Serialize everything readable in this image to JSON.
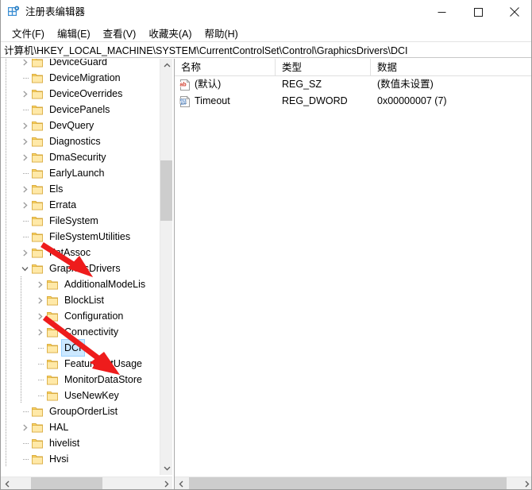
{
  "window": {
    "title": "注册表编辑器",
    "app_icon": "registry-editor-icon",
    "minimize_label": "最小化",
    "maximize_label": "最大化",
    "close_label": "关闭"
  },
  "menubar": {
    "items": [
      {
        "label": "文件(F)",
        "name": "menu-file"
      },
      {
        "label": "编辑(E)",
        "name": "menu-edit"
      },
      {
        "label": "查看(V)",
        "name": "menu-view"
      },
      {
        "label": "收藏夹(A)",
        "name": "menu-favorites"
      },
      {
        "label": "帮助(H)",
        "name": "menu-help"
      }
    ]
  },
  "address": {
    "path": "计算机\\HKEY_LOCAL_MACHINE\\SYSTEM\\CurrentControlSet\\Control\\GraphicsDrivers\\DCI"
  },
  "tree": {
    "items": [
      {
        "label": "DeviceGuard",
        "indent": 1,
        "expandable": true,
        "expanded": false,
        "selected": false
      },
      {
        "label": "DeviceMigration",
        "indent": 1,
        "expandable": false,
        "expanded": false,
        "selected": false
      },
      {
        "label": "DeviceOverrides",
        "indent": 1,
        "expandable": true,
        "expanded": false,
        "selected": false
      },
      {
        "label": "DevicePanels",
        "indent": 1,
        "expandable": false,
        "expanded": false,
        "selected": false
      },
      {
        "label": "DevQuery",
        "indent": 1,
        "expandable": true,
        "expanded": false,
        "selected": false
      },
      {
        "label": "Diagnostics",
        "indent": 1,
        "expandable": true,
        "expanded": false,
        "selected": false
      },
      {
        "label": "DmaSecurity",
        "indent": 1,
        "expandable": true,
        "expanded": false,
        "selected": false
      },
      {
        "label": "EarlyLaunch",
        "indent": 1,
        "expandable": false,
        "expanded": false,
        "selected": false
      },
      {
        "label": "Els",
        "indent": 1,
        "expandable": true,
        "expanded": false,
        "selected": false
      },
      {
        "label": "Errata",
        "indent": 1,
        "expandable": true,
        "expanded": false,
        "selected": false
      },
      {
        "label": "FileSystem",
        "indent": 1,
        "expandable": false,
        "expanded": false,
        "selected": false
      },
      {
        "label": "FileSystemUtilities",
        "indent": 1,
        "expandable": false,
        "expanded": false,
        "selected": false
      },
      {
        "label": "FntAssoc",
        "indent": 1,
        "expandable": true,
        "expanded": false,
        "selected": false
      },
      {
        "label": "GraphicsDrivers",
        "indent": 1,
        "expandable": true,
        "expanded": true,
        "selected": false
      },
      {
        "label": "AdditionalModeLis",
        "indent": 2,
        "expandable": true,
        "expanded": false,
        "selected": false
      },
      {
        "label": "BlockList",
        "indent": 2,
        "expandable": true,
        "expanded": false,
        "selected": false
      },
      {
        "label": "Configuration",
        "indent": 2,
        "expandable": true,
        "expanded": false,
        "selected": false
      },
      {
        "label": "Connectivity",
        "indent": 2,
        "expandable": true,
        "expanded": false,
        "selected": false
      },
      {
        "label": "DCI",
        "indent": 2,
        "expandable": false,
        "expanded": false,
        "selected": true
      },
      {
        "label": "FeatureSetUsage",
        "indent": 2,
        "expandable": false,
        "expanded": false,
        "selected": false
      },
      {
        "label": "MonitorDataStore",
        "indent": 2,
        "expandable": false,
        "expanded": false,
        "selected": false
      },
      {
        "label": "UseNewKey",
        "indent": 2,
        "expandable": false,
        "expanded": false,
        "selected": false
      },
      {
        "label": "GroupOrderList",
        "indent": 1,
        "expandable": false,
        "expanded": false,
        "selected": false
      },
      {
        "label": "HAL",
        "indent": 1,
        "expandable": true,
        "expanded": false,
        "selected": false
      },
      {
        "label": "hivelist",
        "indent": 1,
        "expandable": false,
        "expanded": false,
        "selected": false
      },
      {
        "label": "Hvsi",
        "indent": 1,
        "expandable": false,
        "expanded": false,
        "selected": false
      }
    ]
  },
  "values": {
    "columns": [
      {
        "label": "名称",
        "name": "column-name"
      },
      {
        "label": "类型",
        "name": "column-type"
      },
      {
        "label": "数据",
        "name": "column-data"
      }
    ],
    "rows": [
      {
        "name": "(默认)",
        "type": "REG_SZ",
        "data": "(数值未设置)",
        "icon": "string-value-icon"
      },
      {
        "name": "Timeout",
        "type": "REG_DWORD",
        "data": "0x00000007 (7)",
        "icon": "dword-value-icon"
      }
    ]
  },
  "scrollbars": {
    "tree_vertical": {
      "name": "tree-vertical-scrollbar",
      "up_arrow": "chevron-up-icon",
      "down_arrow": "chevron-down-icon"
    },
    "tree_horizontal": {
      "name": "tree-horizontal-scrollbar",
      "left_arrow": "chevron-left-icon",
      "right_arrow": "chevron-right-icon"
    },
    "value_horizontal": {
      "name": "value-horizontal-scrollbar",
      "left_arrow": "chevron-left-icon",
      "right_arrow": "chevron-right-icon"
    }
  },
  "annotations": {
    "arrows": [
      {
        "name": "annotation-arrow-graphicsdrivers",
        "color": "#ee1c1c",
        "target": "GraphicsDrivers"
      },
      {
        "name": "annotation-arrow-dci",
        "color": "#ee1c1c",
        "target": "DCI"
      }
    ]
  },
  "colors": {
    "selection": "#cce8ff",
    "folder": "#ffe08a",
    "annotation": "#ee1c1c"
  }
}
